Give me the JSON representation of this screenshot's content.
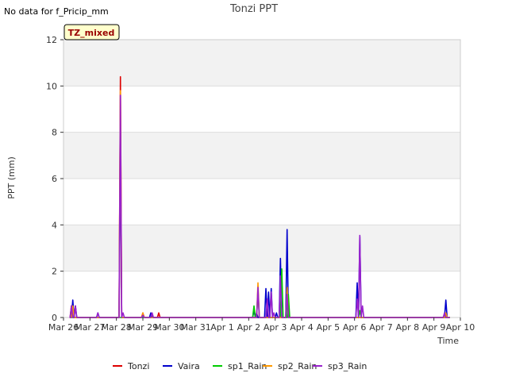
{
  "page": {
    "no_data_note": "No data for f_Pricip_mm",
    "badge_text": "TZ_mixed"
  },
  "chart_data": {
    "type": "line",
    "title": "Tonzi PPT",
    "xlabel": "Time",
    "ylabel": "PPT (mm)",
    "ylim": [
      0,
      12
    ],
    "yticks": [
      0,
      2,
      4,
      6,
      8,
      10,
      12
    ],
    "xlim": [
      0,
      15
    ],
    "xtick_positions": [
      0,
      1,
      2,
      3,
      4,
      5,
      6,
      7,
      8,
      9,
      10,
      11,
      12,
      13,
      14,
      15
    ],
    "xtick_labels": [
      "Mar 26",
      "Mar 27",
      "Mar 28",
      "Mar 29",
      "Mar 30",
      "Mar 31",
      "Apr 1",
      "Apr 2",
      "Apr 3",
      "Apr 4",
      "Apr 5",
      "Apr 6",
      "Apr 7",
      "Apr 8",
      "Apr 9",
      "Apr 10"
    ],
    "grid": true,
    "legend_position": "bottom",
    "colors": {
      "background_band": "#f2f2f2",
      "grid": "#dddddd",
      "badge_fill": "#ffffcc",
      "badge_text": "#990000"
    },
    "series": [
      {
        "name": "Tonzi",
        "color": "#dd0000",
        "points": [
          [
            0.3,
            0.5
          ],
          [
            2.15,
            10.4
          ],
          [
            3.6,
            0.2
          ],
          [
            3.0,
            0.2
          ],
          [
            8.5,
            0.2
          ]
        ]
      },
      {
        "name": "Vaira",
        "color": "#0000cc",
        "points": [
          [
            0.35,
            0.75
          ],
          [
            0.45,
            0.5
          ],
          [
            1.3,
            0.2
          ],
          [
            2.15,
            7.6
          ],
          [
            3.3,
            0.2
          ],
          [
            7.2,
            0.3
          ],
          [
            7.3,
            0.2
          ],
          [
            7.65,
            1.25
          ],
          [
            7.75,
            1.1
          ],
          [
            7.85,
            1.25
          ],
          [
            8.05,
            0.2
          ],
          [
            8.2,
            2.55
          ],
          [
            8.45,
            3.8
          ],
          [
            11.1,
            1.5
          ],
          [
            11.2,
            3.5
          ],
          [
            14.45,
            0.75
          ]
        ]
      },
      {
        "name": "sp1_Rain",
        "color": "#00cc00",
        "points": [
          [
            7.2,
            0.5
          ],
          [
            7.35,
            1.2
          ],
          [
            8.25,
            2.1
          ],
          [
            8.5,
            1.0
          ],
          [
            11.2,
            0.3
          ]
        ]
      },
      {
        "name": "sp2_Rain",
        "color": "#ff9900",
        "points": [
          [
            0.35,
            0.5
          ],
          [
            2.15,
            9.8
          ],
          [
            3.0,
            0.2
          ],
          [
            7.35,
            1.5
          ],
          [
            8.45,
            1.3
          ],
          [
            14.45,
            0.2
          ]
        ]
      },
      {
        "name": "sp3_Rain",
        "color": "#9922cc",
        "points": [
          [
            0.3,
            0.5
          ],
          [
            0.45,
            0.5
          ],
          [
            1.3,
            0.2
          ],
          [
            2.15,
            9.6
          ],
          [
            2.25,
            0.2
          ],
          [
            3.0,
            0.1
          ],
          [
            3.35,
            0.2
          ],
          [
            7.35,
            1.3
          ],
          [
            7.7,
            0.8
          ],
          [
            7.85,
            1.1
          ],
          [
            7.95,
            0.2
          ],
          [
            8.2,
            1.8
          ],
          [
            8.45,
            1.0
          ],
          [
            11.1,
            0.8
          ],
          [
            11.2,
            3.55
          ],
          [
            11.3,
            0.5
          ],
          [
            14.4,
            0.2
          ]
        ]
      }
    ]
  }
}
